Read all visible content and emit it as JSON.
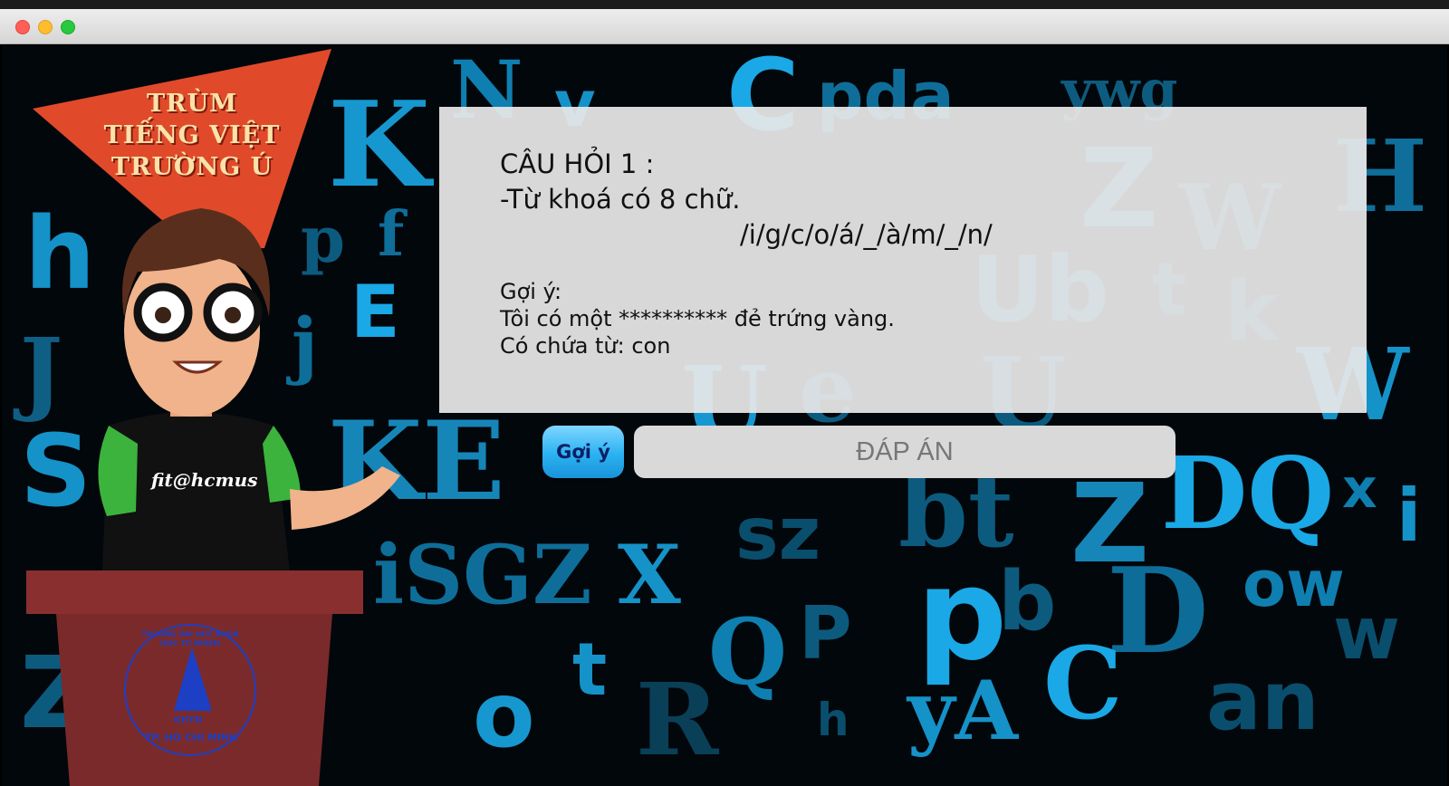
{
  "game": {
    "logo_line1": "TRÙM",
    "logo_line2": "TIẾNG VIỆT",
    "logo_line3": "TRƯỜNG Ú",
    "shirt_text": "fit@hcmus",
    "seal_top": "TRUONG DAI HOC KHOA HOC TU NHIEN",
    "seal_mid": "KHTN",
    "seal_bottom": "TP. HO CHI MINH"
  },
  "question": {
    "title": "CÂU HỎI 1 :",
    "description": "-Từ khoá có 8 chữ.",
    "pattern": "/i/g/c/o/á/_/à/m/_/n/",
    "hint_label": "Gợi ý:",
    "hint_text": "Tôi có một ********** đẻ trứng vàng.",
    "hint_contains": "Có chứa từ: con"
  },
  "controls": {
    "hint_button": "Gợi ý",
    "answer_placeholder": "ĐÁP ÁN"
  },
  "colors": {
    "accent": "#2ab2f2",
    "logo_orange": "#e04a2a",
    "podium": "#8a2f2f"
  }
}
